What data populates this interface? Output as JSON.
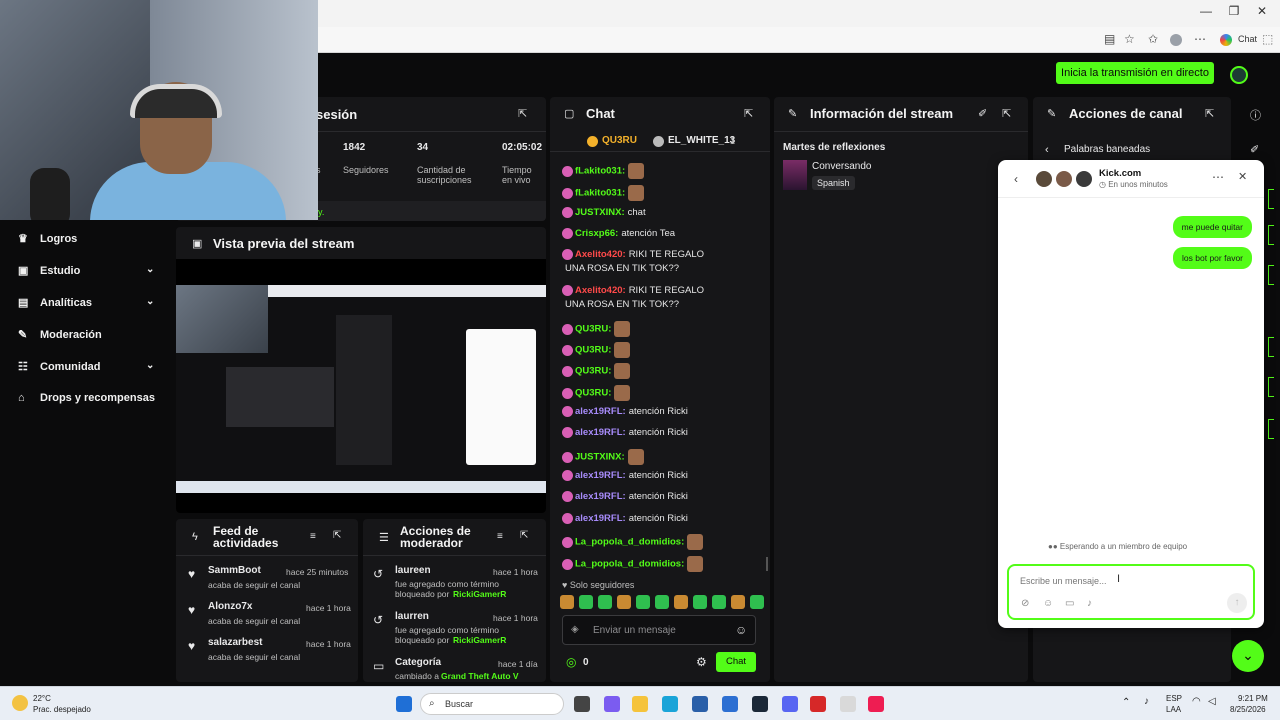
{
  "browser": {
    "chat_button": "Chat",
    "window_controls": [
      "—",
      "❐",
      "✕"
    ]
  },
  "header": {
    "live_button": "Inicia la transmisión en directo"
  },
  "sidebar": {
    "items": [
      {
        "label": "Logros",
        "icon": "trophy-icon",
        "has_chevron": false
      },
      {
        "label": "Estudio",
        "icon": "studio-icon",
        "has_chevron": true
      },
      {
        "label": "Analíticas",
        "icon": "chart-icon",
        "has_chevron": true
      },
      {
        "label": "Moderación",
        "icon": "wrench-icon",
        "has_chevron": false
      },
      {
        "label": "Comunidad",
        "icon": "community-icon",
        "has_chevron": true
      },
      {
        "label": "Drops y recompensas",
        "icon": "gift-icon",
        "has_chevron": false
      }
    ]
  },
  "session": {
    "title": "sesión",
    "stats": [
      {
        "value": "1842",
        "label": "Seguidores"
      },
      {
        "value": "34",
        "label": "Cantidad de suscripciones"
      },
      {
        "value": "02:05:02",
        "label": "Tiempo en vivo"
      }
    ],
    "partial_label": "s",
    "partial_footer": "y."
  },
  "preview": {
    "title": "Vista previa del stream"
  },
  "chat": {
    "title": "Chat",
    "top_users": [
      {
        "rank": "1",
        "name": "QU3RU",
        "count": ""
      },
      {
        "rank": "2",
        "name": "EL_WHITE_13",
        "count": "1"
      }
    ],
    "messages": [
      {
        "user": "fLakito031:",
        "text": "",
        "color": "#53fc18",
        "emote": true
      },
      {
        "user": "fLakito031:",
        "text": "",
        "color": "#53fc18",
        "emote": true
      },
      {
        "user": "JUSTXINX:",
        "text": "chat",
        "color": "#53fc18",
        "emote": false
      },
      {
        "user": "Crisxp66:",
        "text": "atención Tea",
        "color": "#53fc18",
        "emote": false
      },
      {
        "user": "Axelito420:",
        "text": "RIKI TE REGALO",
        "color": "#ff4a4a",
        "emote": false
      },
      {
        "user": "",
        "text": "UNA ROSA EN TIK TOK??",
        "color": "#e6e6e6",
        "emote": false
      },
      {
        "user": "Axelito420:",
        "text": "RIKI TE REGALO",
        "color": "#ff4a4a",
        "emote": false
      },
      {
        "user": "",
        "text": "UNA ROSA EN TIK TOK??",
        "color": "#e6e6e6",
        "emote": false
      },
      {
        "user": "QU3RU:",
        "text": "",
        "color": "#53fc18",
        "emote": true
      },
      {
        "user": "QU3RU:",
        "text": "",
        "color": "#53fc18",
        "emote": true
      },
      {
        "user": "QU3RU:",
        "text": "",
        "color": "#53fc18",
        "emote": true
      },
      {
        "user": "QU3RU:",
        "text": "",
        "color": "#53fc18",
        "emote": true
      },
      {
        "user": "alex19RFL:",
        "text": "atención Ricki",
        "color": "#a78bfa",
        "emote": false
      },
      {
        "user": "alex19RFL:",
        "text": "atención Ricki",
        "color": "#a78bfa",
        "emote": false
      },
      {
        "user": "JUSTXINX:",
        "text": "",
        "color": "#53fc18",
        "emote": true
      },
      {
        "user": "alex19RFL:",
        "text": "atención Ricki",
        "color": "#a78bfa",
        "emote": false
      },
      {
        "user": "alex19RFL:",
        "text": "atención Ricki",
        "color": "#a78bfa",
        "emote": false
      },
      {
        "user": "alex19RFL:",
        "text": "atención Ricki",
        "color": "#a78bfa",
        "emote": false
      },
      {
        "user": "La_popola_d_domidios:",
        "text": "",
        "color": "#53fc18",
        "emote": true
      },
      {
        "user": "La_popola_d_domidios:",
        "text": "",
        "color": "#53fc18",
        "emote": true
      }
    ],
    "followers_only": "Solo seguidores",
    "input_placeholder": "Enviar un mensaje",
    "points": "0",
    "send_button": "Chat"
  },
  "stream_info": {
    "title": "Información del stream",
    "stream_title": "Martes de reflexiones",
    "category": "Conversando",
    "language": "Spanish"
  },
  "channel_actions": {
    "title": "Acciones de canal",
    "sub_title": "Palabras baneadas"
  },
  "activity_feed": {
    "title": "Feed de actividades",
    "items": [
      {
        "user": "SammBoot",
        "time": "hace 25 minutos",
        "text": "acaba de seguir el canal"
      },
      {
        "user": "Alonzo7x",
        "time": "hace 1 hora",
        "text": "acaba de seguir el canal"
      },
      {
        "user": "salazarbest",
        "time": "hace 1 hora",
        "text": "acaba de seguir el canal"
      }
    ]
  },
  "mod_actions": {
    "title": "Acciones de moderador",
    "items": [
      {
        "user": "laureen",
        "time": "hace 1 hora",
        "text": "fue agregado como término bloqueado por",
        "by": "RickiGamerR"
      },
      {
        "user": "laurren",
        "time": "hace 1 hora",
        "text": "fue agregado como término bloqueado por",
        "by": "RickiGamerR"
      },
      {
        "user": "Categoría",
        "time": "hace 1 día",
        "text": "cambiado a",
        "by": "Grand Theft Auto V"
      }
    ]
  },
  "support": {
    "site": "Kick.com",
    "status": "En unos minutos",
    "messages": [
      "me puede quitar",
      "los bot por favor"
    ],
    "waiting": "Esperando a un miembro de equipo",
    "input_placeholder": "Escribe un mensaje..."
  },
  "taskbar": {
    "weather_temp": "22°C",
    "weather_text": "Prac. despejado",
    "search": "Buscar",
    "lang1": "ESP",
    "lang2": "LAA",
    "time": "9:21 PM",
    "date": "8/25/2026"
  },
  "colors": {
    "accent": "#53fc18",
    "panel": "#161618",
    "bg": "#0b0b0c"
  }
}
